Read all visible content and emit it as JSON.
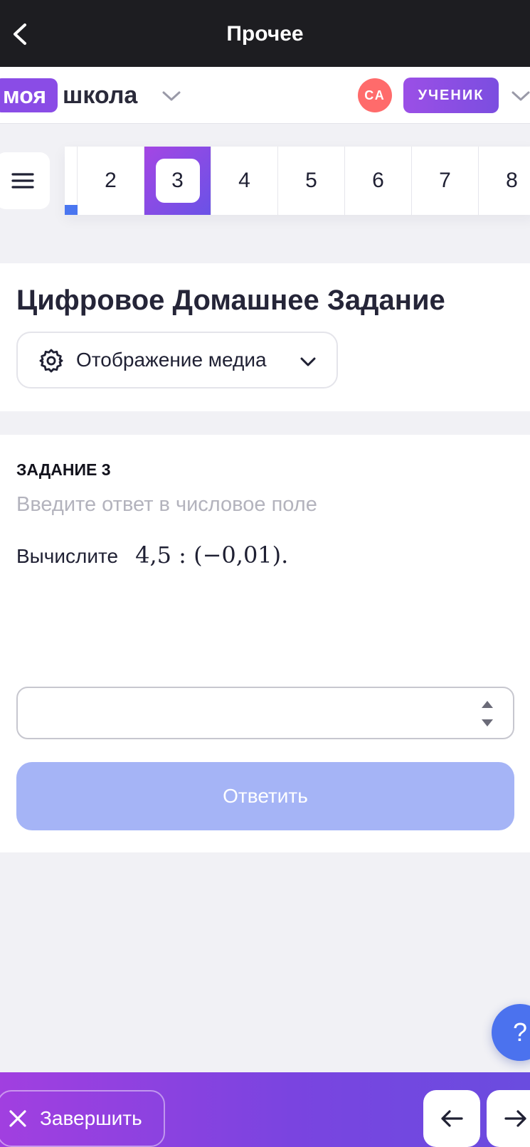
{
  "topbar": {
    "title": "Прочее"
  },
  "brand": {
    "badge": "моя",
    "name": "школа"
  },
  "user": {
    "initials": "СА",
    "role": "УЧЕНИК"
  },
  "tasks": {
    "numbers": [
      "2",
      "3",
      "4",
      "5",
      "6",
      "7",
      "8"
    ],
    "active": "3"
  },
  "header": {
    "title": "Цифровое Домашнее Задание",
    "media_label": "Отображение медиа"
  },
  "task": {
    "label": "ЗАДАНИЕ 3",
    "hint": "Введите ответ в числовое поле",
    "question_word": "Вычислите",
    "expression": "4,5 : (−0,01).",
    "answer_value": "",
    "submit_label": "Ответить"
  },
  "help": {
    "label": "?"
  },
  "footer": {
    "finish_label": "Завершить"
  },
  "colors": {
    "accent_purple": "#8a4ce6",
    "accent_blue": "#4b72ee",
    "submit_disabled": "#a5b4f6",
    "avatar": "#ff6b6b"
  }
}
